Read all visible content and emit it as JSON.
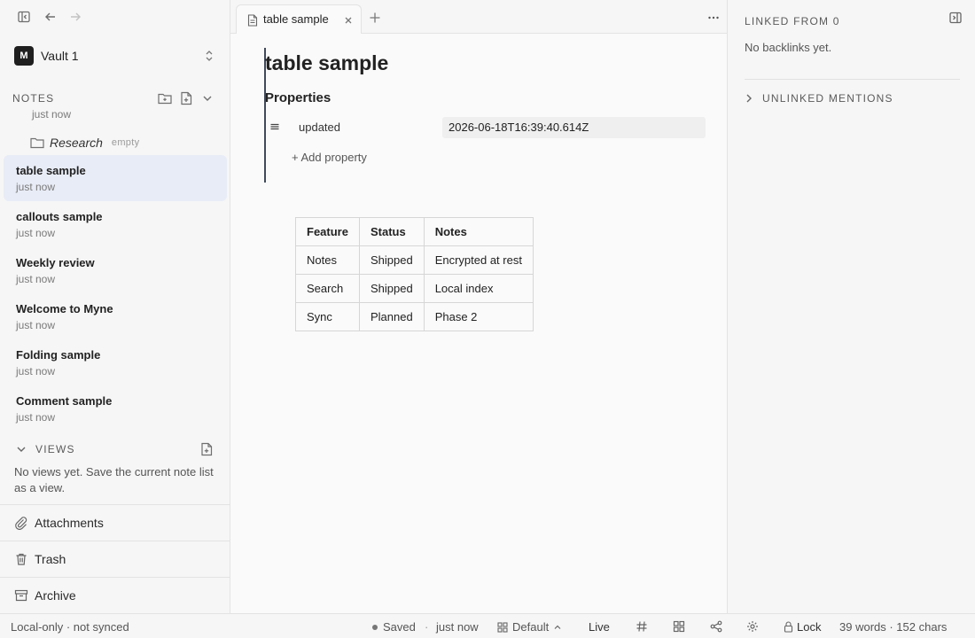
{
  "sidebar": {
    "vault": {
      "badge": "M",
      "name": "Vault 1"
    },
    "notes_header": "NOTES",
    "partial_item_time": "just now",
    "folder": {
      "name": "Research",
      "badge": "empty"
    },
    "notes": [
      {
        "title": "table sample",
        "time": "just now",
        "active": true
      },
      {
        "title": "callouts sample",
        "time": "just now"
      },
      {
        "title": "Weekly review",
        "time": "just now"
      },
      {
        "title": "Welcome to Myne",
        "time": "just now"
      },
      {
        "title": "Folding sample",
        "time": "just now"
      },
      {
        "title": "Comment sample",
        "time": "just now"
      }
    ],
    "views": {
      "header": "VIEWS",
      "empty_text": "No views yet. Save the current note list as a view."
    },
    "bottom_links": [
      {
        "label": "Attachments",
        "icon": "paperclip-icon"
      },
      {
        "label": "Trash",
        "icon": "trash-icon"
      },
      {
        "label": "Archive",
        "icon": "archive-icon"
      }
    ]
  },
  "editor": {
    "tab": {
      "label": "table sample"
    },
    "doc_title": "table sample",
    "properties_label": "Properties",
    "property": {
      "key": "updated",
      "value": "2026-06-18T16:39:40.614Z"
    },
    "add_property": "+ Add property",
    "table": {
      "headers": [
        "Feature",
        "Status",
        "Notes"
      ],
      "rows": [
        [
          "Notes",
          "Shipped",
          "Encrypted at rest"
        ],
        [
          "Search",
          "Shipped",
          "Local index"
        ],
        [
          "Sync",
          "Planned",
          "Phase 2"
        ]
      ]
    }
  },
  "right_panel": {
    "linked_header": "LINKED FROM 0",
    "empty_text": "No backlinks yet.",
    "unlinked_header": "UNLINKED MENTIONS"
  },
  "statusbar": {
    "sync_status": "Local-only · not synced",
    "saved": "Saved",
    "separator": "·",
    "saved_time": "just now",
    "layout": "Default",
    "mode": "Live",
    "lock": "Lock",
    "counts": "39 words · 152 chars"
  }
}
